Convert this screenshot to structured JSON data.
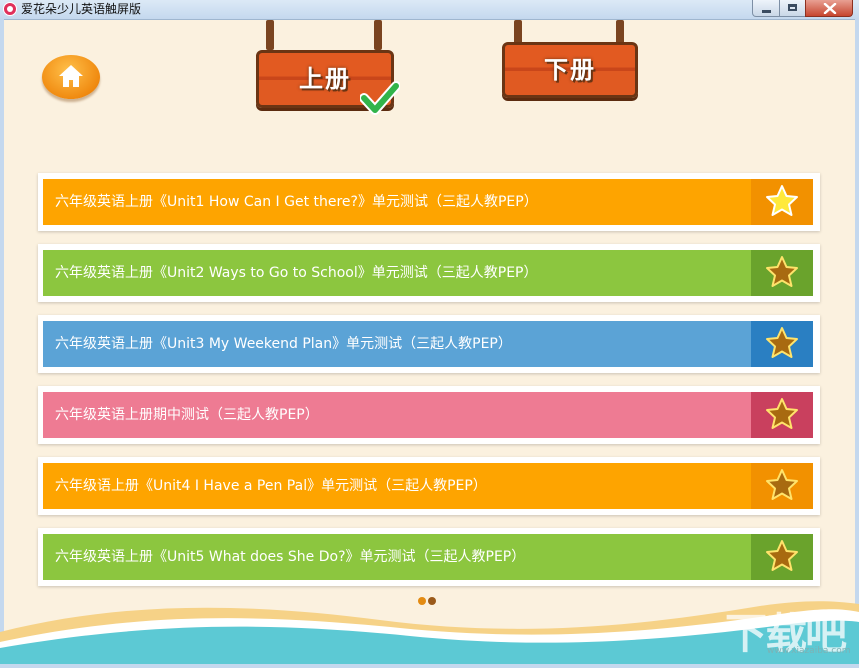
{
  "window": {
    "title": "爱花朵少儿英语触屏版"
  },
  "nav": {
    "home_icon": "home-icon",
    "volume_up_label": "上册",
    "volume_down_label": "下册",
    "selected": "上册"
  },
  "items": [
    {
      "label": "六年级英语上册《Unit1 How Can I Get there?》单元测试（三起人教PEP）",
      "color": "#fea400",
      "star_bg": "#f29100",
      "star_active": true
    },
    {
      "label": "六年级英语上册《Unit2 Ways to Go to School》单元测试（三起人教PEP）",
      "color": "#8cc63f",
      "star_bg": "#6aa32c",
      "star_active": false
    },
    {
      "label": "六年级英语上册《Unit3 My Weekend Plan》单元测试（三起人教PEP）",
      "color": "#5ba3d6",
      "star_bg": "#2a7fc2",
      "star_active": false
    },
    {
      "label": "六年级英语上册期中测试（三起人教PEP）",
      "color": "#ee7b93",
      "star_bg": "#c9405e",
      "star_active": false
    },
    {
      "label": "六年级语上册《Unit4 I Have a Pen Pal》单元测试（三起人教PEP）",
      "color": "#fea400",
      "star_bg": "#f29100",
      "star_active": false
    },
    {
      "label": "六年级英语上册《Unit5 What does She Do?》单元测试（三起人教PEP）",
      "color": "#8cc63f",
      "star_bg": "#6aa32c",
      "star_active": false
    }
  ],
  "pager": {
    "pages": 2,
    "current": 1
  },
  "watermark": {
    "text": "下载吧",
    "url": "www.xiazaiba.com"
  }
}
